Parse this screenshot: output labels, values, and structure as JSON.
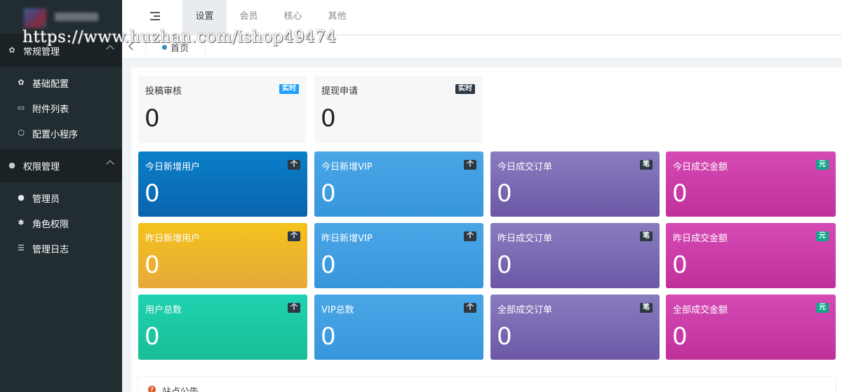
{
  "watermark": "https://www.huzhan.com/ishop49474",
  "sidebar": {
    "groups": [
      {
        "label": "常规管理",
        "items": [
          {
            "label": "基础配置",
            "icon": "gear-icon"
          },
          {
            "label": "附件列表",
            "icon": "folder-icon"
          },
          {
            "label": "配置小程序",
            "icon": "cube-icon"
          }
        ]
      },
      {
        "label": "权限管理",
        "items": [
          {
            "label": "管理员",
            "icon": "user-circle-icon"
          },
          {
            "label": "角色权限",
            "icon": "bug-icon"
          },
          {
            "label": "管理日志",
            "icon": "list-icon"
          }
        ]
      }
    ]
  },
  "topnav": {
    "tabs": [
      "设置",
      "会员",
      "核心",
      "其他"
    ],
    "active": "设置"
  },
  "breadcrumb": {
    "tab": "首页"
  },
  "review_cards": [
    {
      "label": "投稿审核",
      "badge": "实时",
      "value": "0",
      "badge_color": "#1e9fff"
    },
    {
      "label": "提现申请",
      "badge": "实时",
      "value": "0",
      "badge_color": "#2c3945"
    }
  ],
  "stat_rows": [
    [
      {
        "label": "今日新增用户",
        "badge": "个",
        "value": "0"
      },
      {
        "label": "今日新增VIP",
        "badge": "个",
        "value": "0"
      },
      {
        "label": "今日成交订单",
        "badge": "笔",
        "value": "0"
      },
      {
        "label": "今日成交金额",
        "badge": "元",
        "value": "0"
      }
    ],
    [
      {
        "label": "昨日新增用户",
        "badge": "个",
        "value": "0"
      },
      {
        "label": "昨日新增VIP",
        "badge": "个",
        "value": "0"
      },
      {
        "label": "昨日成交订单",
        "badge": "笔",
        "value": "0"
      },
      {
        "label": "昨日成交金额",
        "badge": "元",
        "value": "0"
      }
    ],
    [
      {
        "label": "用户总数",
        "badge": "个",
        "value": "0"
      },
      {
        "label": "VIP总数",
        "badge": "个",
        "value": "0"
      },
      {
        "label": "全部成交订单",
        "badge": "笔",
        "value": "0"
      },
      {
        "label": "全部成交金额",
        "badge": "元",
        "value": "0"
      }
    ]
  ],
  "colors": {
    "blue_dark": "#0a6fb8",
    "blue_light": "#3d9fe0",
    "purple": "#7e6bb3",
    "magenta": "#cf3ea9",
    "yellow": "#eeb41e",
    "teal": "#1dc7a2",
    "badge_green": "#12a58a"
  },
  "announcement": {
    "title": "站点公告"
  }
}
